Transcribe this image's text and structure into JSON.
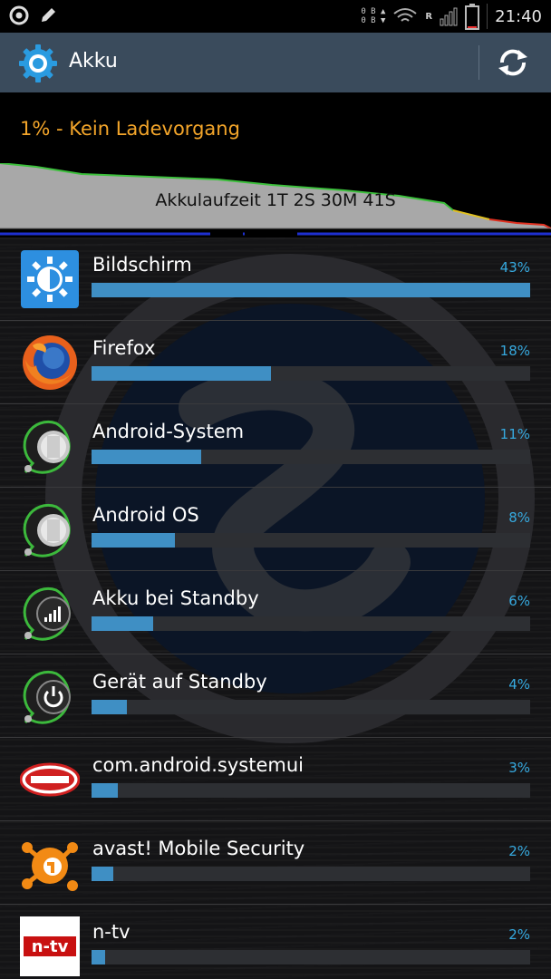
{
  "status_bar": {
    "time": "21:40",
    "data_up": "0 B",
    "data_down": "0 B",
    "roaming_letter": "R"
  },
  "action_bar": {
    "title": "Akku",
    "accent": "#3a4b5c"
  },
  "battery": {
    "status_text": "1% - Kein Ladevorgang",
    "runtime_label": "Akkulaufzeit 1T 2S 30M 41S",
    "status_color": "#f3a52a"
  },
  "usage": [
    {
      "name": "Bildschirm",
      "percent_label": "43%",
      "fraction": 1.0,
      "icon": "screen-brightness-icon"
    },
    {
      "name": "Firefox",
      "percent_label": "18%",
      "fraction": 0.41,
      "icon": "firefox-icon"
    },
    {
      "name": "Android-System",
      "percent_label": "11%",
      "fraction": 0.25,
      "icon": "android-system-icon"
    },
    {
      "name": "Android OS",
      "percent_label": "8%",
      "fraction": 0.19,
      "icon": "android-os-icon"
    },
    {
      "name": "Akku bei Standby",
      "percent_label": "6%",
      "fraction": 0.14,
      "icon": "signal-bars-icon"
    },
    {
      "name": "Gerät auf Standby",
      "percent_label": "4%",
      "fraction": 0.08,
      "icon": "power-icon"
    },
    {
      "name": "com.android.systemui",
      "percent_label": "3%",
      "fraction": 0.06,
      "icon": "famous-logo-icon"
    },
    {
      "name": "avast! Mobile Security",
      "percent_label": "2%",
      "fraction": 0.05,
      "icon": "avast-icon"
    },
    {
      "name": "n-tv",
      "percent_label": "2%",
      "fraction": 0.03,
      "icon": "ntv-logo-icon"
    }
  ]
}
